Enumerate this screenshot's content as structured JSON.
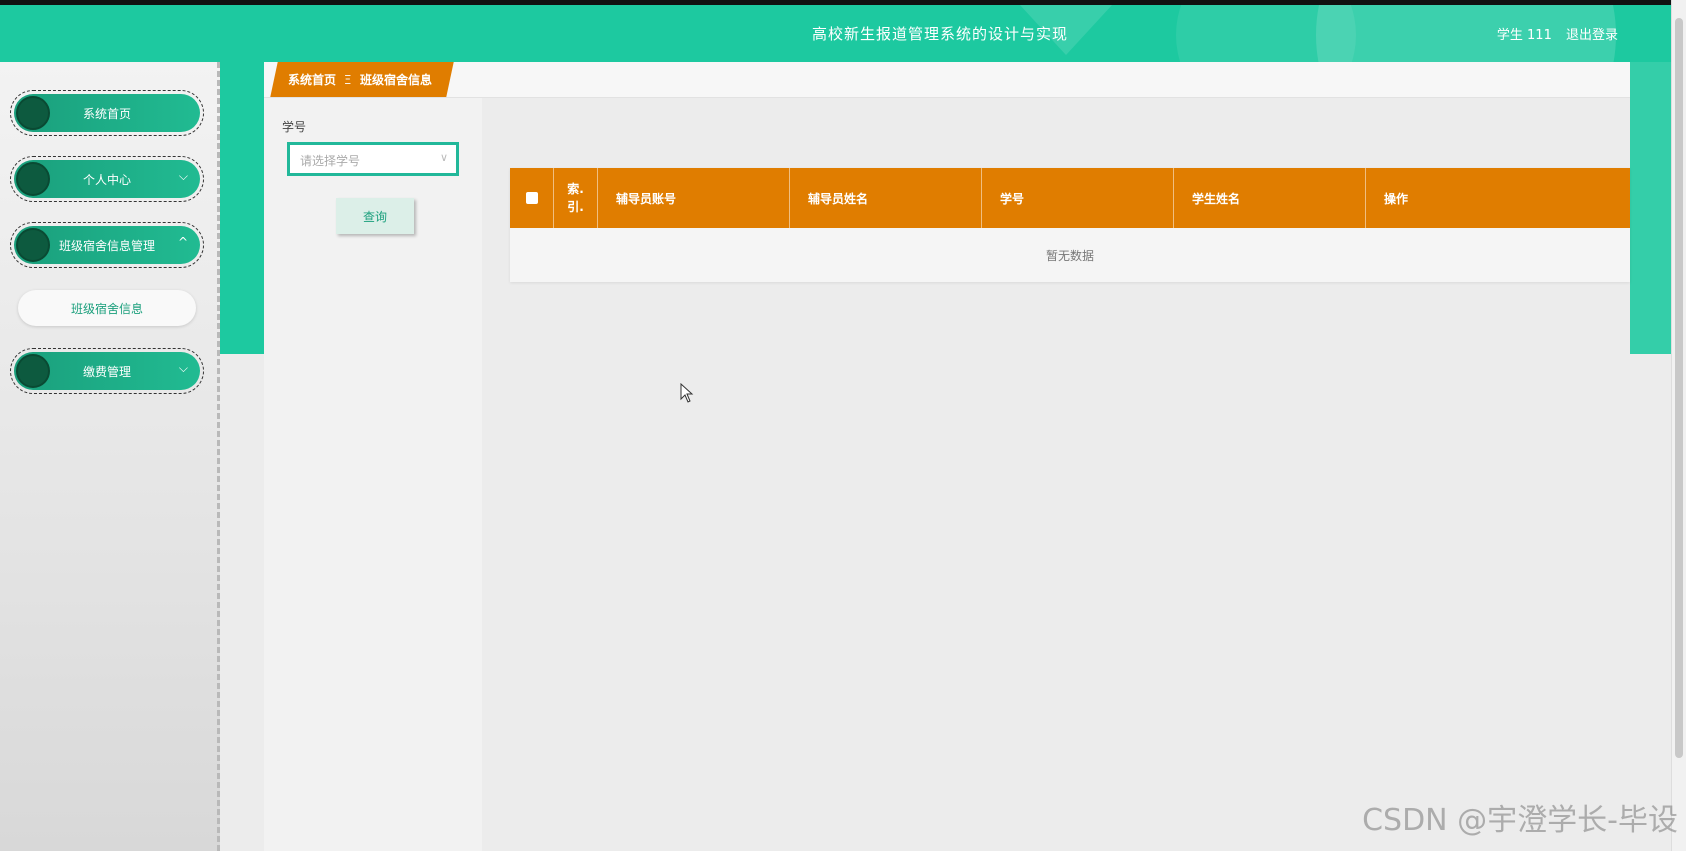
{
  "header": {
    "title": "高校新生报道管理系统的设计与实现",
    "user": "学生 111",
    "logout": "退出登录"
  },
  "sidebar": {
    "items": [
      {
        "label": "系统首页"
      },
      {
        "label": "个人中心",
        "arrow": "⌵"
      },
      {
        "label": "班级宿舍信息管理",
        "arrow": "^"
      },
      {
        "label": "缴费管理",
        "arrow": "⌵"
      }
    ],
    "submenu": {
      "label": "班级宿舍信息"
    }
  },
  "breadcrumb": {
    "home": "系统首页",
    "separator": "Ξ",
    "current": "班级宿舍信息"
  },
  "search": {
    "label": "学号",
    "select_placeholder": "请选择学号",
    "button": "查询"
  },
  "table": {
    "columns": [
      "索引",
      "辅导员账号",
      "辅导员姓名",
      "学号",
      "学生姓名",
      "操作"
    ],
    "index_col_line1": "索.",
    "index_col_line2": "引.",
    "empty_text": "暂无数据"
  },
  "watermark": "CSDN @宇澄学长-毕设",
  "colors": {
    "primary": "#1dc9a0",
    "accent": "#e07d00",
    "sidebar_pill": "#1a9f7c"
  }
}
